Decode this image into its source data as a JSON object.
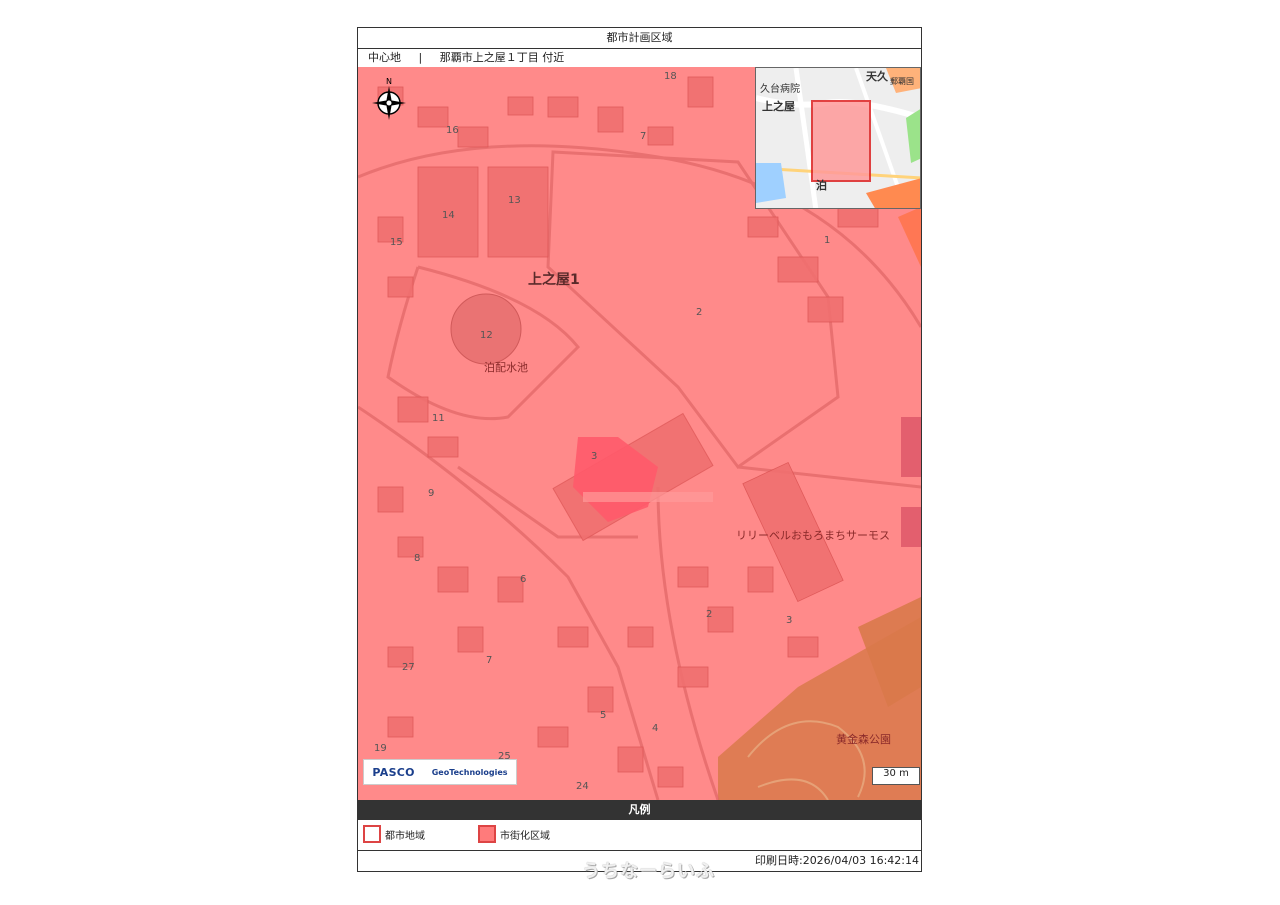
{
  "sheet": {
    "title": "都市計画区域",
    "center_label": "中心地",
    "separator": "|",
    "center_address": "那覇市上之屋１丁目 付近"
  },
  "map": {
    "district_label": "上之屋1",
    "pois": [
      {
        "name": "泊配水池"
      },
      {
        "name": "リリーベルおもろまちサーモス"
      },
      {
        "name": "黄金森公園"
      }
    ],
    "block_numbers": [
      "18",
      "16",
      "7",
      "13",
      "14",
      "15",
      "1",
      "2",
      "12",
      "11",
      "3",
      "9",
      "8",
      "6",
      "2",
      "3",
      "7",
      "27",
      "5",
      "4",
      "19",
      "25",
      "24"
    ],
    "inset_labels": {
      "hospital": "久台病院",
      "area1": "上之屋",
      "area2": "泊",
      "corner1": "天久",
      "corner2": "郵覇国"
    },
    "logos": {
      "pasco": "PASCO",
      "geo": "GeoTechnologies"
    },
    "scale_label": "30  m",
    "compass_letter": "N",
    "colors": {
      "urbanization_fill": "#ff8a8a",
      "park_fill": "#d9794a",
      "boundary": "#d44444"
    }
  },
  "legend": {
    "title": "凡例",
    "items": [
      {
        "label": "都市地域"
      },
      {
        "label": "市街化区域"
      }
    ]
  },
  "footer": {
    "printed": "印刷日時:2026/04/03 16:42:14"
  },
  "watermark": "うちなーらいふ"
}
